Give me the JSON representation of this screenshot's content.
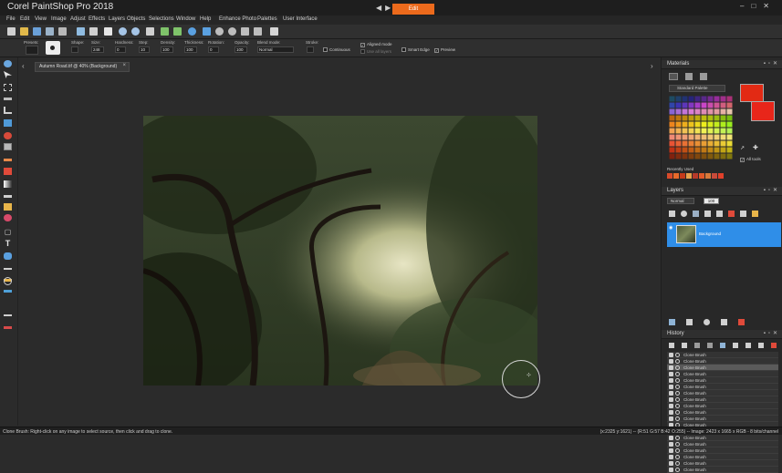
{
  "app": {
    "title": "Corel PaintShop Pro 2018",
    "active_workspace_tab": "Edit"
  },
  "menu": [
    "File",
    "Edit",
    "View",
    "Image",
    "Adjust",
    "Effects",
    "Layers",
    "Objects",
    "Selections",
    "Window",
    "Help",
    "Enhance Photo",
    "Palettes",
    "User Interface"
  ],
  "options_bar": {
    "presets_label": "Presets:",
    "shape_label": "Shape:",
    "size_label": "Size:",
    "size_value": "248",
    "hardness_label": "Hardness:",
    "hardness_value": "0",
    "step_label": "Step:",
    "step_value": "10",
    "density_label": "Density:",
    "density_value": "100",
    "thickness_label": "Thickness:",
    "thickness_value": "100",
    "rotation_label": "Rotation:",
    "rotation_value": "0",
    "opacity_label": "Opacity:",
    "opacity_value": "100",
    "blend_label": "Blend mode:",
    "blend_value": "Normal",
    "stroke_label": "Stroke:",
    "continuous_label": "Continuous",
    "aligned_label": "Aligned mode",
    "use_all_layers_label": "Use all layers",
    "smart_edge_label": "Smart Edge",
    "preview_label": "Preview"
  },
  "document": {
    "tab_label": "Autumn Road.tif @  40% (Background)"
  },
  "materials": {
    "title": "Materials",
    "palette": "Standard Palette",
    "all_tools_label": "All tools",
    "recently_used_label": "Recently Used",
    "foreground_color": "#e22a14",
    "background_color": "#e8261a"
  },
  "layers": {
    "title": "Layers",
    "blend_mode": "Normal",
    "opacity": "100",
    "items": [
      {
        "name": "Background"
      }
    ]
  },
  "history": {
    "title": "History",
    "items": [
      "Clone Brush",
      "Clone Brush",
      "Clone Brush",
      "Clone Brush",
      "Clone Brush",
      "Clone Brush",
      "Clone Brush",
      "Clone Brush",
      "Clone Brush",
      "Clone Brush",
      "Clone Brush",
      "Clone Brush",
      "Clone Brush",
      "Clone Brush",
      "Clone Brush",
      "Clone Brush",
      "Clone Brush",
      "Clone Brush",
      "Clone Brush"
    ],
    "selected_index": 2
  },
  "status": {
    "left": "Clone Brush: Right-click on any image to select source, then click and drag to clone.",
    "right": "(x:2325 y:1621) -- (R:51 G:57 B:42 O:255) -- Image:  2423 x 1665 x RGB - 8 bits/channel"
  }
}
